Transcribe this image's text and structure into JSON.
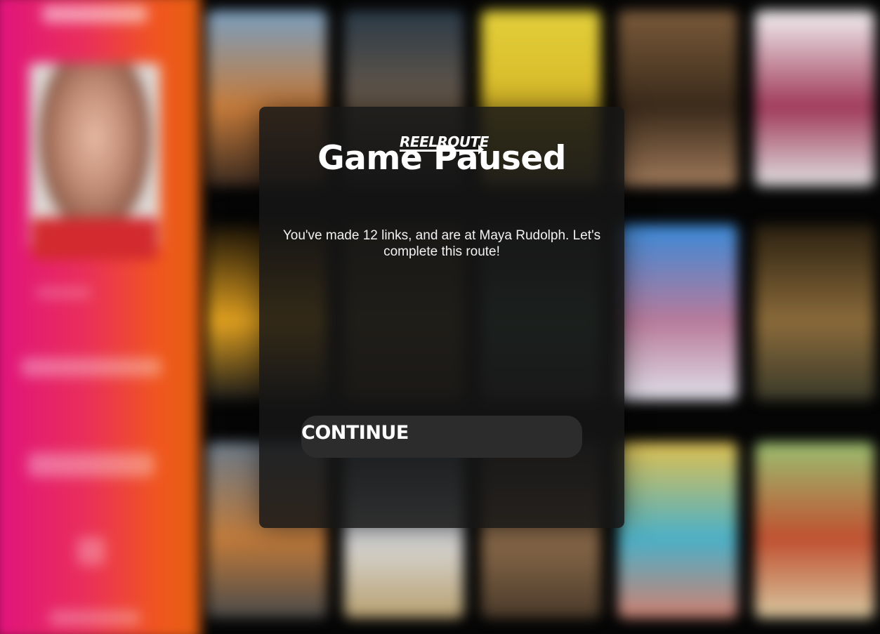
{
  "modal": {
    "logo": "REELROUTE",
    "title": "Game Paused",
    "message": "You've made 12 links, and are at Maya Rudolph. Let's complete this route!",
    "continue_label": "CONTINUE"
  },
  "background_posters": [
    {
      "colors": [
        "#7a9fc0",
        "#c47a3a",
        "#3a2a20"
      ]
    },
    {
      "colors": [
        "#2a3a48",
        "#6a5a4a",
        "#1a1a1a"
      ]
    },
    {
      "colors": [
        "#e2cf3a",
        "#d8b828",
        "#6a5a2a"
      ]
    },
    {
      "colors": [
        "#7a5a3a",
        "#3a2a1a",
        "#a07a5a"
      ]
    },
    {
      "colors": [
        "#f2f2f2",
        "#a03a5a",
        "#e0e0e0"
      ]
    },
    {
      "colors": [
        "#1a1208",
        "#e0a020",
        "#1a1a1a"
      ]
    },
    {
      "colors": [
        "#2a2418",
        "#5a4a2a",
        "#3a2a1a"
      ]
    },
    {
      "colors": [
        "#1a1a1a",
        "#3a5a48",
        "#2a2a2a"
      ]
    },
    {
      "colors": [
        "#3a8ad8",
        "#b87a9a",
        "#e0e0ea"
      ]
    },
    {
      "colors": [
        "#2a2010",
        "#8a6a3a",
        "#3a3a2a"
      ]
    },
    {
      "colors": [
        "#6a7a8a",
        "#c07a3a",
        "#4a4a4a"
      ]
    },
    {
      "colors": [
        "#3a4a5a",
        "#d8d8d8",
        "#b8a070"
      ]
    },
    {
      "colors": [
        "#2a2a2a",
        "#8a6a4a",
        "#4a3a2a"
      ]
    },
    {
      "colors": [
        "#e0c050",
        "#4ab0c8",
        "#d08070"
      ]
    },
    {
      "colors": [
        "#9ac070",
        "#c05030",
        "#d8c8a0"
      ]
    }
  ]
}
